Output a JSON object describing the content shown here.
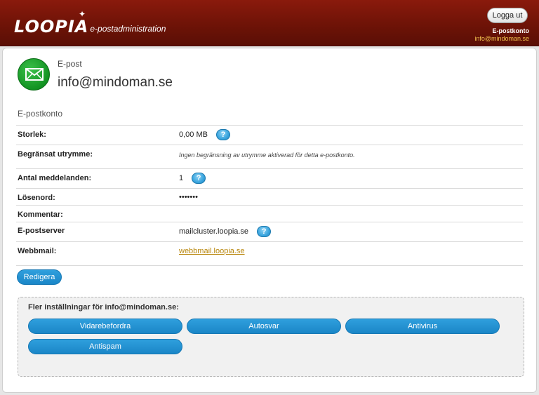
{
  "header": {
    "logo_word": "LOOPIA",
    "logo_subtitle": "e-postadministration",
    "logout_label": "Logga ut",
    "account_label": "E-postkonto",
    "account_email": "info@mindoman.se"
  },
  "summary": {
    "type_label": "E-post",
    "email": "info@mindoman.se"
  },
  "account": {
    "section_title": "E-postkonto",
    "rows": [
      {
        "label": "Storlek:",
        "value": "0,00 MB",
        "help": true
      },
      {
        "label": "Begränsat utrymme:",
        "value": "Ingen begränsning av utrymme aktiverad för detta e-postkonto."
      },
      {
        "label": "Antal meddelanden:",
        "value": "1",
        "help": true
      },
      {
        "label": "Lösenord:",
        "value": "•••••••"
      },
      {
        "label": "Kommentar:",
        "value": ""
      },
      {
        "label": "E-postserver",
        "value": "mailcluster.loopia.se",
        "help": true
      },
      {
        "label": "Webbmail:",
        "value": "webbmail.loopia.se"
      }
    ],
    "help_symbol": "?",
    "edit_label": "Redigera"
  },
  "more": {
    "title": "Fler inställningar för info@mindoman.se:",
    "buttons": [
      "Vidarebefordra",
      "Autosvar",
      "Antivirus",
      "Antispam"
    ]
  },
  "colors": {
    "header_bg": "#6e1307",
    "button_blue": "#1a86c7",
    "link_gold": "#b8860b",
    "icon_green": "#129322"
  }
}
